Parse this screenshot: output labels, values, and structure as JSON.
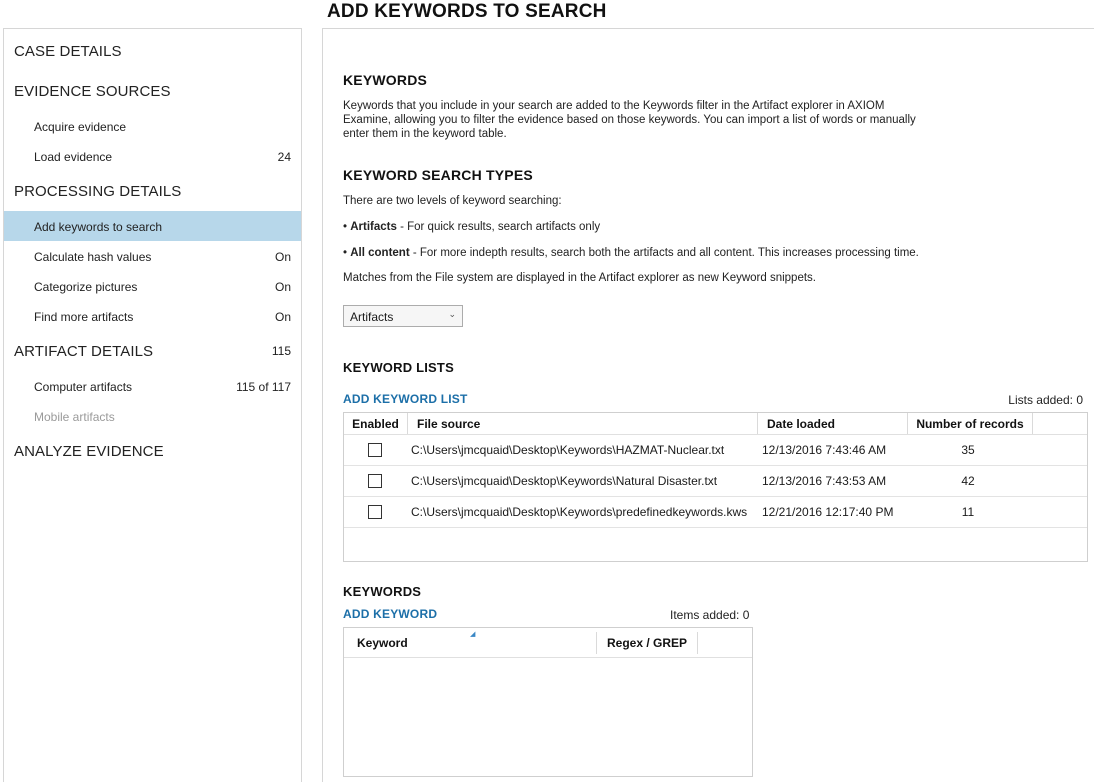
{
  "page": {
    "title": "ADD KEYWORDS TO SEARCH"
  },
  "sidebar": {
    "case_details": "CASE DETAILS",
    "evidence_sources": {
      "label": "EVIDENCE SOURCES",
      "items": [
        {
          "label": "Acquire evidence",
          "value": ""
        },
        {
          "label": "Load evidence",
          "value": "24"
        }
      ]
    },
    "processing_details": {
      "label": "PROCESSING DETAILS",
      "items": [
        {
          "label": "Add keywords to search",
          "value": ""
        },
        {
          "label": "Calculate hash values",
          "value": "On"
        },
        {
          "label": "Categorize pictures",
          "value": "On"
        },
        {
          "label": "Find more artifacts",
          "value": "On"
        }
      ]
    },
    "artifact_details": {
      "label": "ARTIFACT DETAILS",
      "value": "115",
      "items": [
        {
          "label": "Computer artifacts",
          "value": "115 of 117"
        },
        {
          "label": "Mobile artifacts",
          "value": ""
        }
      ]
    },
    "analyze_evidence": "ANALYZE EVIDENCE"
  },
  "main": {
    "keywords_heading": "KEYWORDS",
    "keywords_desc_1": "Keywords that you include in your search are added to the Keywords filter in the Artifact explorer in AXIOM",
    "keywords_desc_2": "Examine, allowing you to filter the evidence based on those keywords. You can import a list of words or manually",
    "keywords_desc_3": "enter them in the keyword table.",
    "search_types_heading": "KEYWORD SEARCH TYPES",
    "levels_text": "There are two levels of keyword searching:",
    "artifacts_bold": "Artifacts",
    "artifacts_desc": " - For quick results, search artifacts only",
    "allcontent_bold": "All content",
    "allcontent_desc": " - For more indepth results, search both the artifacts and all content. This increases processing time.",
    "matches_text": "Matches from the File system are displayed in the Artifact explorer as new Keyword snippets.",
    "dropdown": {
      "selected": "Artifacts"
    },
    "keyword_lists": {
      "heading": "KEYWORD LISTS",
      "add_link": "ADD KEYWORD LIST",
      "count": "Lists added: 0",
      "columns": [
        "Enabled",
        "File source",
        "Date loaded",
        "Number of records"
      ],
      "rows": [
        {
          "file": "C:\\Users\\jmcquaid\\Desktop\\Keywords\\HAZMAT-Nuclear.txt",
          "date": "12/13/2016 7:43:46 AM",
          "records": "35"
        },
        {
          "file": "C:\\Users\\jmcquaid\\Desktop\\Keywords\\Natural Disaster.txt",
          "date": "12/13/2016 7:43:53 AM",
          "records": "42"
        },
        {
          "file": "C:\\Users\\jmcquaid\\Desktop\\Keywords\\predefinedkeywords.kws",
          "date": "12/21/2016 12:17:40 PM",
          "records": "11"
        }
      ]
    },
    "keywords_section": {
      "heading": "KEYWORDS",
      "add_link": "ADD KEYWORD",
      "count": "Items added: 0",
      "columns": [
        "Keyword",
        "Regex / GREP"
      ]
    }
  },
  "colors": {
    "active_bg": "#b7d7ea",
    "link": "#1c6fa8"
  },
  "icons": {
    "dropdown": "chevron-down-icon",
    "sort": "sort-ascending-icon"
  }
}
